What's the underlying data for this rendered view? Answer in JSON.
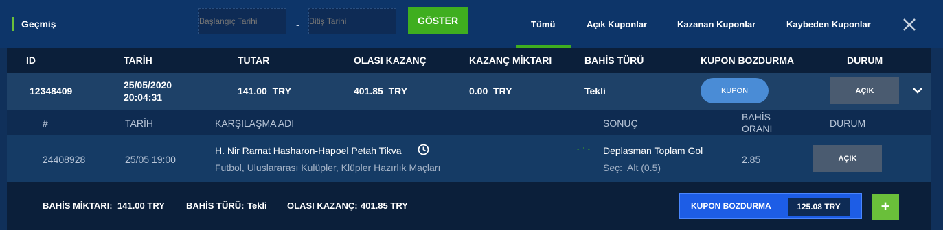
{
  "header": {
    "title": "Geçmiş",
    "start_date_placeholder": "Başlangıç Tarihi",
    "end_date_placeholder": "Bitiş Tarihi",
    "dash": "-",
    "show_button": "GÖSTER",
    "tabs": [
      {
        "label": "Tümü",
        "active": true
      },
      {
        "label": "Açık Kuponlar",
        "active": false
      },
      {
        "label": "Kazanan Kuponlar",
        "active": false
      },
      {
        "label": "Kaybeden Kuponlar",
        "active": false
      }
    ],
    "close_icon": "close-icon"
  },
  "columns": [
    "ID",
    "TARİH",
    "TUTAR",
    "OLASI KAZANÇ",
    "KAZANÇ MİKTARI",
    "BAHİS TÜRÜ",
    "KUPON BOZDURMA",
    "DURUM"
  ],
  "coupon": {
    "id": "12348409",
    "date_line1": "25/05/2020",
    "date_line2": "20:04:31",
    "amount": "141.00  TRY",
    "possible_win": "401.85  TRY",
    "win_amount": "0.00  TRY",
    "bet_type": "Tekli",
    "cashout_button": "KUPON",
    "status": "AÇIK",
    "expand_icon": "chevron-down-icon"
  },
  "detail_columns": {
    "number": "#",
    "date": "TARİH",
    "match_name": "KARŞILAŞMA ADI",
    "result": "SONUÇ",
    "odds_line1": "BAHİS",
    "odds_line2": "ORANI",
    "status": "DURUM"
  },
  "detail": {
    "number": "24408928",
    "date": "25/05 19:00",
    "match": "H. Nir Ramat Hasharon-Hapoel Petah Tikva",
    "league": "Futbol, Uluslararası Kulüpler, Klüpler Hazırlık Maçları",
    "score": "- : -",
    "market": "Deplasman Toplam Gol",
    "selection": "Seç:  Alt (0.5)",
    "odds": "2.85",
    "status": "AÇIK",
    "clock_icon": "clock-icon"
  },
  "footer": {
    "bet_amount_label": "BAHİS MİKTARI:",
    "bet_amount": "141.00 TRY",
    "bet_type_label": "BAHİS TÜRÜ:",
    "bet_type": "Tekli",
    "possible_win_label": "OLASI KAZANÇ:",
    "possible_win": "401.85 TRY",
    "cashout_label": "KUPON BOZDURMA",
    "cashout_amount": "125.08 TRY",
    "plus": "+"
  },
  "colors": {
    "accent_green": "#3fae1f",
    "header_blue": "#0d3569",
    "cashout_blue": "#1d5de6",
    "pill_blue": "#4a8cd6",
    "status_gray": "#4a5b70"
  }
}
